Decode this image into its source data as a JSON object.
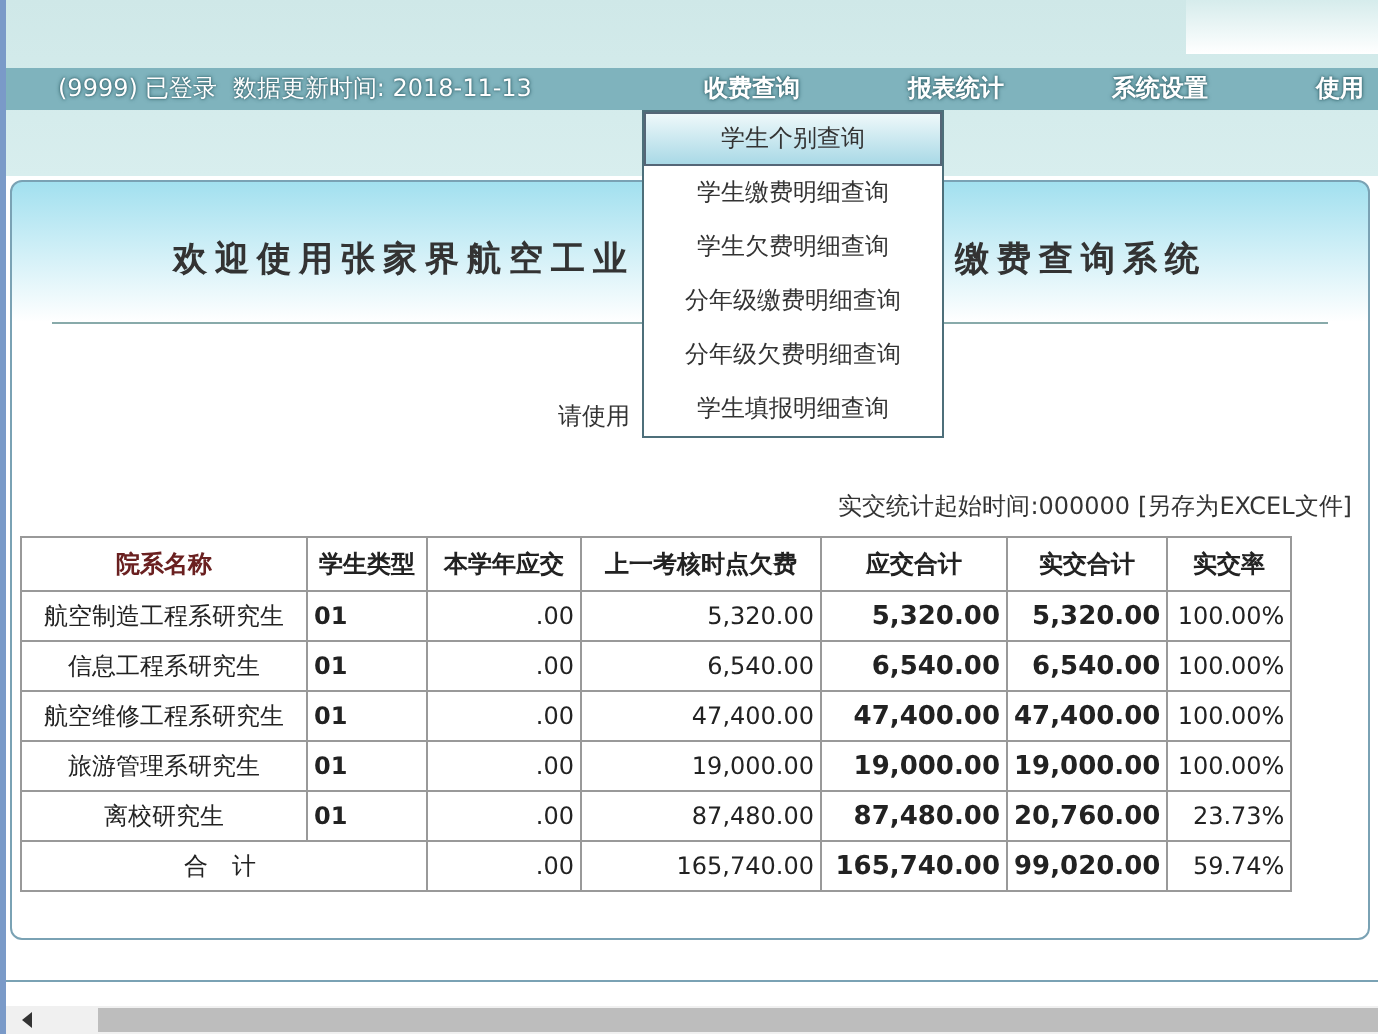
{
  "header": {
    "status": "(9999) 已登录  数据更新时间: 2018-11-13",
    "nav": [
      "收费查询",
      "报表统计",
      "系统设置",
      "使用"
    ]
  },
  "dropdown": [
    {
      "label": "学生个别查询",
      "selected": true
    },
    {
      "label": "学生缴费明细查询",
      "selected": false
    },
    {
      "label": "学生欠费明细查询",
      "selected": false
    },
    {
      "label": "分年级缴费明细查询",
      "selected": false
    },
    {
      "label": "分年级欠费明细查询",
      "selected": false
    },
    {
      "label": "学生填报明细查询",
      "selected": false
    }
  ],
  "panel": {
    "title_left": "欢迎使用张家界航空工业",
    "title_right": "缴费查询系统",
    "hint": "请使用",
    "stat_label": "实交统计起始时间:000000",
    "export_link": "[另存为EXCEL文件]"
  },
  "table": {
    "columns": [
      "院系名称",
      "学生类型",
      "本学年应交",
      "上一考核时点欠费",
      "应交合计",
      "实交合计",
      "实交率"
    ],
    "rows": [
      [
        "航空制造工程系研究生",
        "01",
        ".00",
        "5,320.00",
        "5,320.00",
        "5,320.00",
        "100.00%"
      ],
      [
        "信息工程系研究生",
        "01",
        ".00",
        "6,540.00",
        "6,540.00",
        "6,540.00",
        "100.00%"
      ],
      [
        "航空维修工程系研究生",
        "01",
        ".00",
        "47,400.00",
        "47,400.00",
        "47,400.00",
        "100.00%"
      ],
      [
        "旅游管理系研究生",
        "01",
        ".00",
        "19,000.00",
        "19,000.00",
        "19,000.00",
        "100.00%"
      ],
      [
        "离校研究生",
        "01",
        ".00",
        "87,480.00",
        "87,480.00",
        "20,760.00",
        "23.73%"
      ]
    ],
    "total": [
      "合 计",
      ".00",
      "165,740.00",
      "165,740.00",
      "99,020.00",
      "59.74%"
    ]
  }
}
